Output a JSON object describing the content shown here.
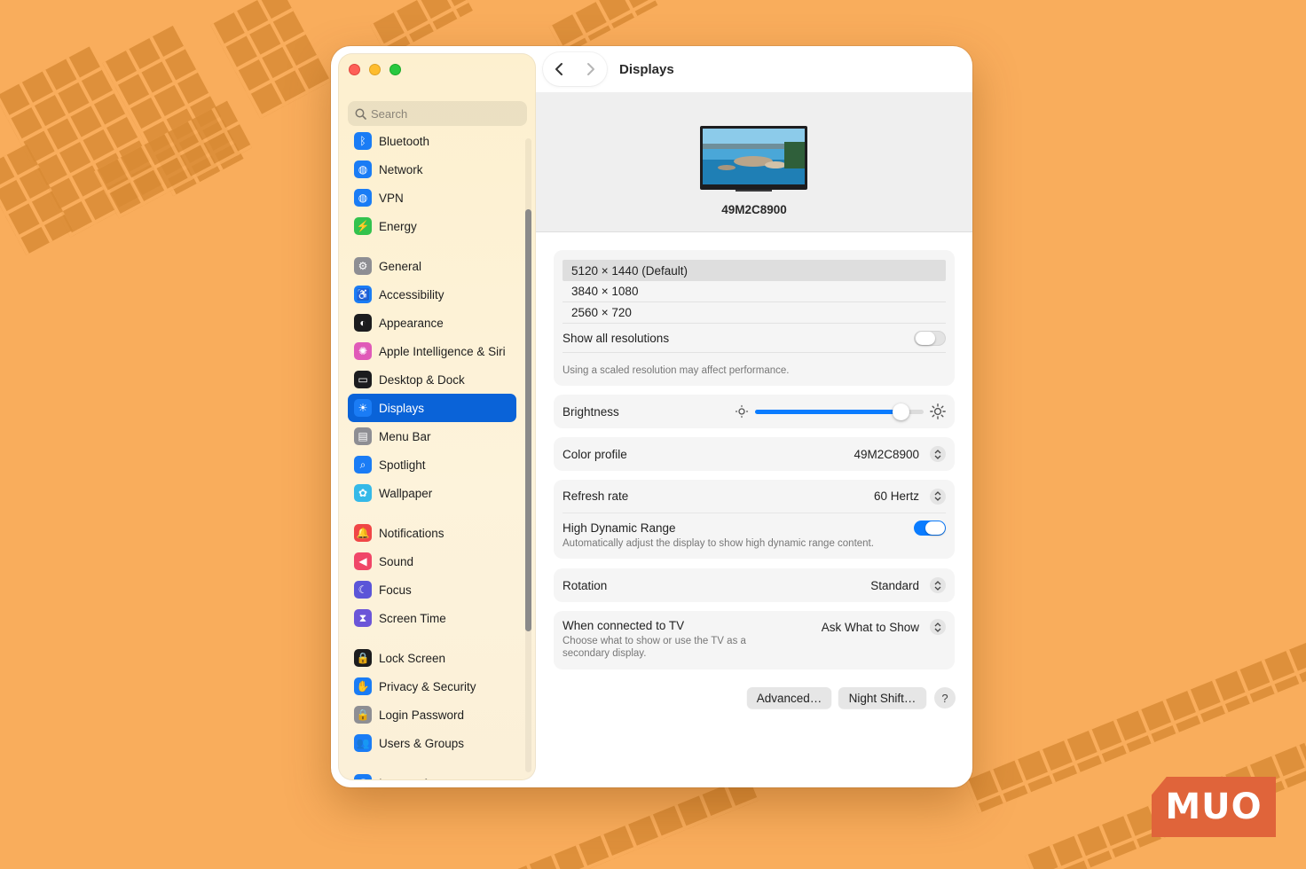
{
  "window": {
    "title": "Displays"
  },
  "sidebar": {
    "search_placeholder": "Search",
    "groups": [
      [
        {
          "label": "Bluetooth",
          "icon": "bluetooth-icon",
          "color": "#1a7cf5"
        },
        {
          "label": "Network",
          "icon": "globe-icon",
          "color": "#1a7cf5"
        },
        {
          "label": "VPN",
          "icon": "vpn-globe-icon",
          "color": "#1a7cf5"
        },
        {
          "label": "Energy",
          "icon": "bolt-icon",
          "color": "#33c24d"
        }
      ],
      [
        {
          "label": "General",
          "icon": "gear-icon",
          "color": "#8e8e93"
        },
        {
          "label": "Accessibility",
          "icon": "accessibility-icon",
          "color": "#1a7cf5"
        },
        {
          "label": "Appearance",
          "icon": "appearance-icon",
          "color": "#1c1c1e"
        },
        {
          "label": "Apple Intelligence & Siri",
          "icon": "siri-icon",
          "color": "#e05ab8"
        },
        {
          "label": "Desktop & Dock",
          "icon": "dock-icon",
          "color": "#1c1c1e"
        },
        {
          "label": "Displays",
          "icon": "sun-icon",
          "color": "#1a7cf5",
          "active": true
        },
        {
          "label": "Menu Bar",
          "icon": "menubar-icon",
          "color": "#8e8e93"
        },
        {
          "label": "Spotlight",
          "icon": "magnifier-icon",
          "color": "#1a7cf5"
        },
        {
          "label": "Wallpaper",
          "icon": "flower-icon",
          "color": "#35b9e8"
        }
      ],
      [
        {
          "label": "Notifications",
          "icon": "bell-icon",
          "color": "#f04646"
        },
        {
          "label": "Sound",
          "icon": "speaker-icon",
          "color": "#f04668"
        },
        {
          "label": "Focus",
          "icon": "moon-icon",
          "color": "#5b55d8"
        },
        {
          "label": "Screen Time",
          "icon": "hourglass-icon",
          "color": "#6b55d8"
        }
      ],
      [
        {
          "label": "Lock Screen",
          "icon": "lock-icon",
          "color": "#1c1c1e"
        },
        {
          "label": "Privacy & Security",
          "icon": "hand-icon",
          "color": "#1a7cf5"
        },
        {
          "label": "Login Password",
          "icon": "padlock-icon",
          "color": "#8e8e93"
        },
        {
          "label": "Users & Groups",
          "icon": "users-icon",
          "color": "#1a7cf5"
        }
      ],
      [
        {
          "label": "Internet Accounts",
          "icon": "at-icon",
          "color": "#1a7cf5"
        }
      ]
    ]
  },
  "display": {
    "name": "49M2C8900",
    "resolutions": [
      "5120 × 1440 (Default)",
      "3840 × 1080",
      "2560 × 720"
    ],
    "selected_resolution_index": 0,
    "show_all_label": "Show all resolutions",
    "show_all_on": false,
    "scaled_note": "Using a scaled resolution may affect performance.",
    "brightness_label": "Brightness",
    "brightness_level": 0.87,
    "color_profile_label": "Color profile",
    "color_profile_value": "49M2C8900",
    "refresh_label": "Refresh rate",
    "refresh_value": "60 Hertz",
    "hdr_label": "High Dynamic Range",
    "hdr_desc": "Automatically adjust the display to show high dynamic range content.",
    "hdr_on": true,
    "rotation_label": "Rotation",
    "rotation_value": "Standard",
    "tv_label": "When connected to TV",
    "tv_desc": "Choose what to show or use the TV as a secondary display.",
    "tv_value": "Ask What to Show",
    "advanced_label": "Advanced…",
    "nightshift_label": "Night Shift…",
    "help_label": "?"
  },
  "watermark": {
    "text": "MUO"
  },
  "colors": {
    "accent": "#0a63d8",
    "background": "#f9ad5c"
  }
}
